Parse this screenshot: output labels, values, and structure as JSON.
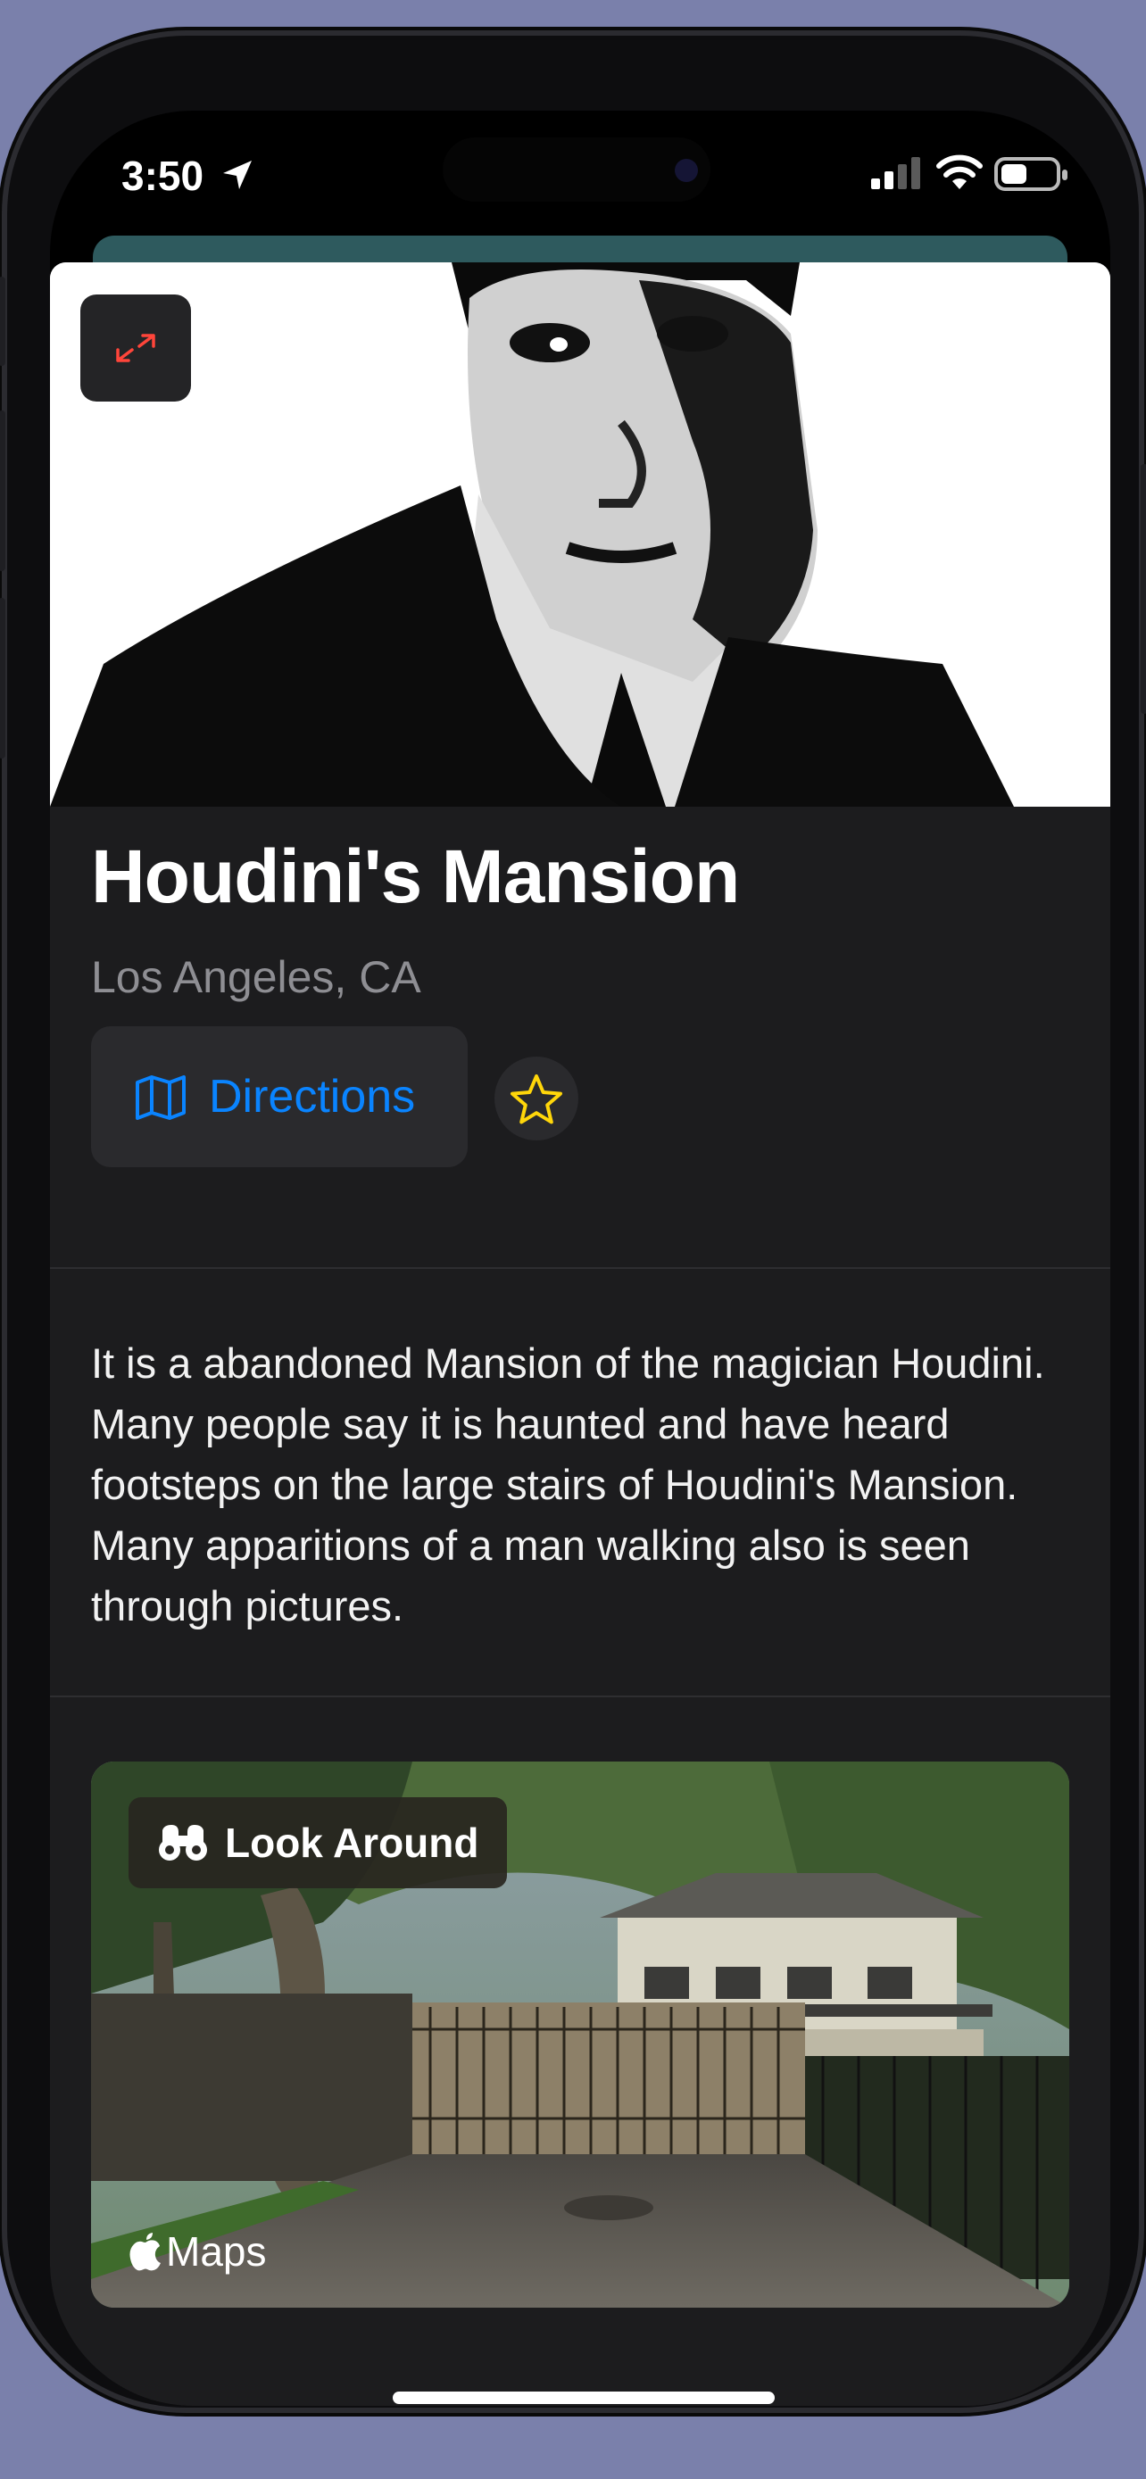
{
  "status_bar": {
    "time": "3:50"
  },
  "place": {
    "title": "Houdini's Mansion",
    "subtitle": "Los Angeles, CA",
    "directions_label": "Directions",
    "description": "It is a abandoned Mansion of the magician Houdini. Many people say it is haunted and have heard footsteps on the large stairs of Houdini's Mansion. Many apparitions of a man walking also is seen through pictures."
  },
  "look_around": {
    "badge_label": "Look Around",
    "maps_label": "Maps"
  },
  "colors": {
    "accent": "#0a84ff",
    "star": "#ffd60a",
    "expand_icon": "#ff453a",
    "sheet_bg": "#1c1c1e"
  },
  "icons": [
    "location-arrow-icon",
    "cellular-signal-icon",
    "wifi-icon",
    "battery-icon",
    "expand-icon",
    "map-icon",
    "star-icon",
    "binoculars-icon",
    "apple-logo-icon"
  ]
}
